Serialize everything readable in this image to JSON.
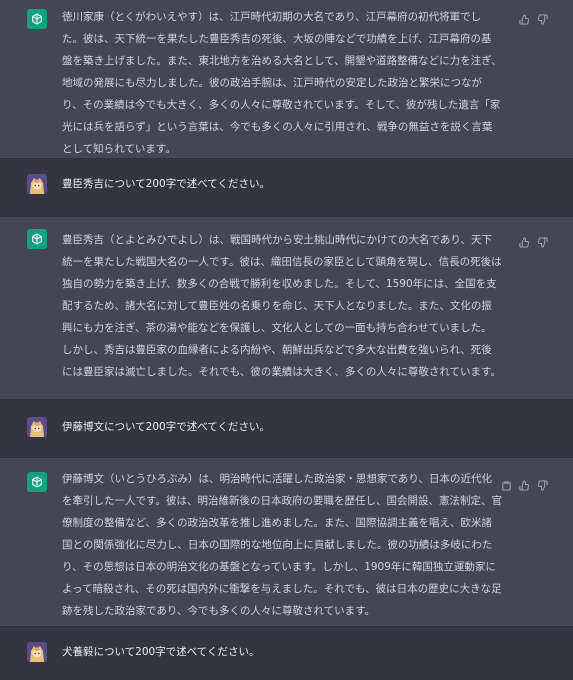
{
  "messages": [
    {
      "role": "assistant",
      "text": "徳川家康（とくがわいえやす）は、江戸時代初期の大名であり、江戸幕府の初代将軍でした。彼は、天下統一を果たした豊臣秀吉の死後、大坂の陣などで功績を上げ、江戸幕府の基盤を築き上げました。また、東北地方を治める大名として、開墾や道路整備などに力を注ぎ、地域の発展にも尽力しました。彼の政治手腕は、江戸時代の安定した政治と繁栄につながり、その業績は今でも大きく、多くの人々に尊敬されています。そして、彼が残した遺言「家光には兵を語らず」という言葉は、今でも多くの人々に引用され、戦争の無益さを説く言葉として知られています。"
    },
    {
      "role": "user",
      "text": "豊臣秀吉について200字で述べてください。"
    },
    {
      "role": "assistant",
      "text": "豊臣秀吉（とよとみひでよし）は、戦国時代から安土桃山時代にかけての大名であり、天下統一を果たした戦国大名の一人です。彼は、織田信長の家臣として頭角を現し、信長の死後は独自の勢力を築き上げ、数多くの合戦で勝利を収めました。そして、1590年には、全国を支配するため、諸大名に対して豊臣姓の名乗りを命じ、天下人となりました。また、文化の振興にも力を注ぎ、茶の湯や能などを保護し、文化人としての一面も持ち合わせていました。しかし、秀吉は豊臣家の血縁者による内紛や、朝鮮出兵などで多大な出費を強いられ、死後には豊臣家は滅亡しました。それでも、彼の業績は大きく、多くの人々に尊敬されています。"
    },
    {
      "role": "user",
      "text": "伊藤博文について200字で述べてください。"
    },
    {
      "role": "assistant",
      "text": "伊藤博文（いとうひろぶみ）は、明治時代に活躍した政治家・思想家であり、日本の近代化を牽引した一人です。彼は、明治維新後の日本政府の要職を歴任し、国会開設、憲法制定、官僚制度の整備など、多くの政治改革を推し進めました。また、国際協調主義を唱え、欧米諸国との関係強化に尽力し、日本の国際的な地位向上に貢献しました。彼の功績は多岐にわたり、その思想は日本の明治文化の基盤となっています。しかし、1909年に韓国独立運動家によって暗殺され、その死は国内外に衝撃を与えました。それでも、彼は日本の歴史に大きな足跡を残した政治家であり、今でも多くの人々に尊敬されています。"
    },
    {
      "role": "user",
      "text": "犬養毅について200字で述べてください。"
    }
  ],
  "icons": {
    "assistant_avatar": "openai-logo-icon",
    "user_avatar": "anime-avatar-icon",
    "thumbs_up": "thumbs-up-icon",
    "thumbs_down": "thumbs-down-icon",
    "copy": "clipboard-icon"
  },
  "colors": {
    "assistant_bg": "#444654",
    "user_bg": "#343541",
    "gpt_avatar": "#10a37f",
    "text": "#d1d5db"
  }
}
